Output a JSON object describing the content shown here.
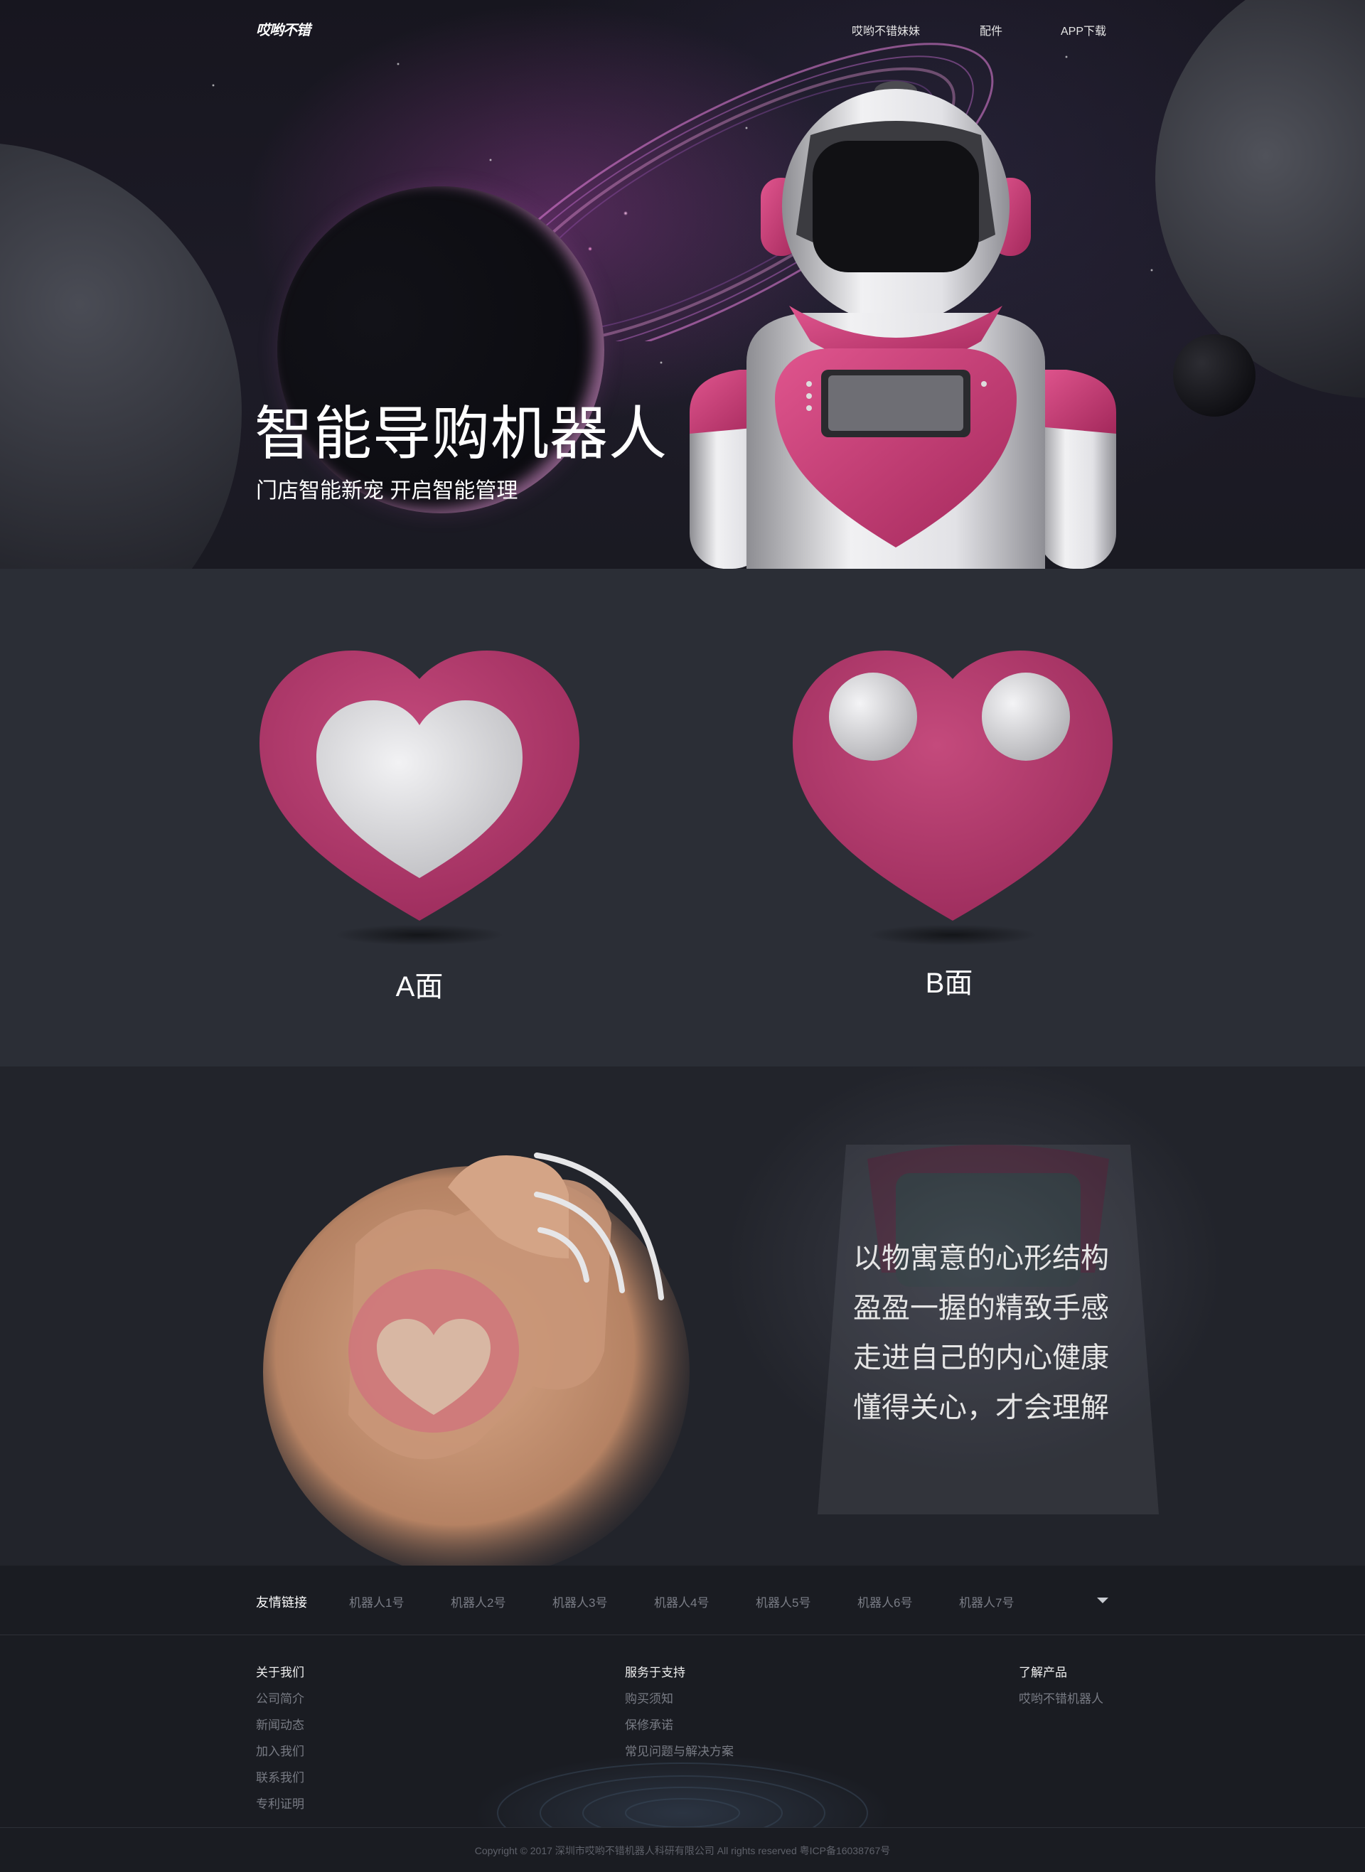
{
  "nav": {
    "logo": "哎哟不错",
    "links": [
      "哎哟不错妹妹",
      "配件",
      "APP下载"
    ]
  },
  "hero": {
    "title": "智能导购机器人",
    "subtitle": "门店智能新宠 开启智能管理"
  },
  "hearts": {
    "a_label": "A面",
    "b_label": "B面",
    "color": "#b33a6a"
  },
  "feature": {
    "lines": [
      "以物寓意的心形结构",
      "盈盈一握的精致手感",
      "走进自己的内心健康",
      "懂得关心，才会理解"
    ]
  },
  "links_bar": {
    "title": "友情链接",
    "links": [
      "机器人1号",
      "机器人2号",
      "机器人3号",
      "机器人4号",
      "机器人5号",
      "机器人6号",
      "机器人7号"
    ]
  },
  "footer": {
    "columns": [
      {
        "title": "关于我们",
        "links": [
          "公司简介",
          "新闻动态",
          "加入我们",
          "联系我们",
          "专利证明"
        ]
      },
      {
        "title": "服务于支持",
        "links": [
          "购买须知",
          "保修承诺",
          "常见问题与解决方案"
        ]
      },
      {
        "title": "了解产品",
        "links": [
          "哎哟不错机器人"
        ]
      }
    ],
    "copyright": "Copyright © 2017 深圳市哎哟不错机器人科研有限公司 All rights reserved 粤ICP备16038767号"
  }
}
